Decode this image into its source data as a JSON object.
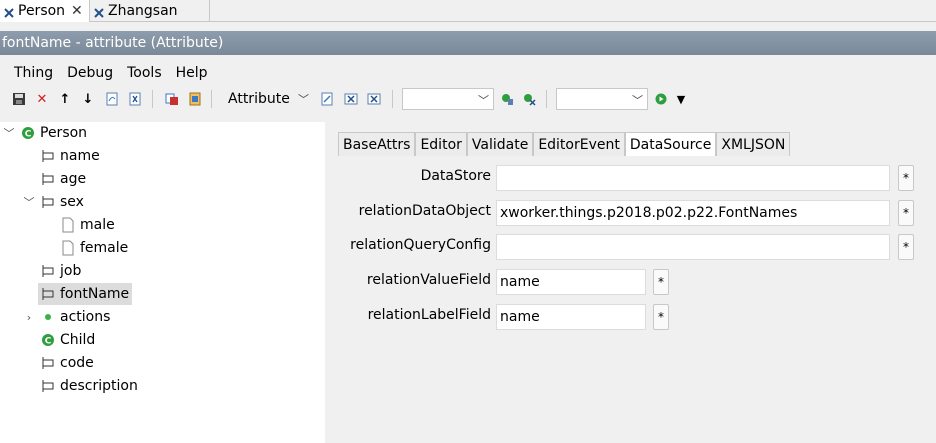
{
  "tabs": [
    {
      "label": "Person",
      "icon": "thing-icon",
      "active": true
    },
    {
      "label": "Zhangsan",
      "icon": "thing-icon",
      "active": false
    }
  ],
  "title": "fontName - attribute  (Attribute)",
  "menu": [
    "Thing",
    "Debug",
    "Tools",
    "Help"
  ],
  "toolbar": {
    "combo_type": "Attribute",
    "combo2": "",
    "combo3": ""
  },
  "tree": [
    {
      "label": "Person",
      "icon": "class-icon",
      "expanded": true
    },
    {
      "label": "name",
      "icon": "attribute-icon"
    },
    {
      "label": "age",
      "icon": "attribute-icon"
    },
    {
      "label": "sex",
      "icon": "attribute-icon",
      "expanded": true
    },
    {
      "label": "male",
      "icon": "file-icon"
    },
    {
      "label": "female",
      "icon": "file-icon"
    },
    {
      "label": "job",
      "icon": "attribute-icon"
    },
    {
      "label": "fontName",
      "icon": "attribute-icon",
      "selected": true
    },
    {
      "label": "actions",
      "icon": "dot-icon",
      "collapsed": true
    },
    {
      "label": "Child",
      "icon": "class-icon"
    },
    {
      "label": "code",
      "icon": "attribute-icon"
    },
    {
      "label": "description",
      "icon": "attribute-icon"
    }
  ],
  "editor_tabs": [
    "BaseAttrs",
    "Editor",
    "Validate",
    "EditorEvent",
    "DataSource",
    "XMLJSON"
  ],
  "active_editor_tab": "DataSource",
  "fields": [
    {
      "label": "DataStore",
      "value": ""
    },
    {
      "label": "relationDataObject",
      "value": "xworker.things.p2018.p02.p22.FontNames"
    },
    {
      "label": "relationQueryConfig",
      "value": ""
    },
    {
      "label": "relationValueField",
      "value": "name"
    },
    {
      "label": "relationLabelField",
      "value": "name"
    }
  ],
  "star_label": "*",
  "close_glyph": "✕",
  "colors": {
    "titlebar": "#8090a0",
    "green": "#2e9e3e",
    "selection": "#dcdcdc"
  }
}
